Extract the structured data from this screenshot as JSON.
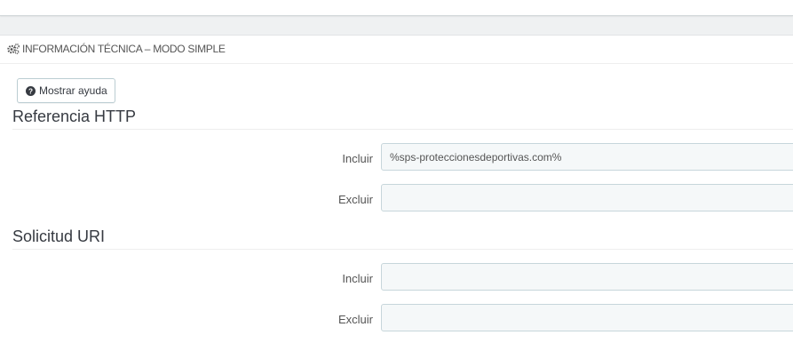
{
  "panel": {
    "title": "Información técnica – modo simple",
    "help_button_label": "Mostrar ayuda"
  },
  "sections": [
    {
      "heading": "Referencia HTTP",
      "include_label": "Incluir",
      "include_value": "%sps-proteccionesdeportivas.com%",
      "exclude_label": "Excluir",
      "exclude_value": ""
    },
    {
      "heading": "Solicitud URI",
      "include_label": "Incluir",
      "include_value": "",
      "exclude_label": "Excluir",
      "exclude_value": ""
    }
  ],
  "icons": {
    "panel_icon": "gears-icon",
    "help_icon": "question-circle-icon"
  },
  "colors": {
    "input_bg": "#f5f8f9",
    "input_border": "#c7d6db",
    "text": "#555555",
    "heading": "#363a41"
  }
}
